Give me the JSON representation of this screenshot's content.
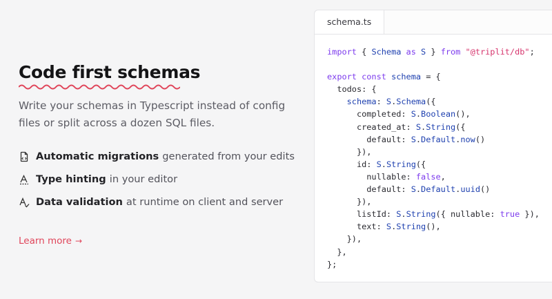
{
  "section": {
    "title": "Code first schemas",
    "description": "Write your schemas in Typescript instead of config files or split across a dozen SQL files.",
    "features": [
      {
        "icon": "file-code-icon",
        "bold": "Automatic migrations",
        "rest": "generated from your edits"
      },
      {
        "icon": "text-hint-icon",
        "bold": "Type hinting",
        "rest": "in your editor"
      },
      {
        "icon": "text-check-icon",
        "bold": "Data validation",
        "rest": "at runtime on client and server"
      }
    ],
    "learn_more": "Learn more",
    "learn_more_arrow": "→"
  },
  "editor": {
    "tab": "schema.ts",
    "code_lines": [
      [
        [
          "kw",
          "import"
        ],
        [
          "pr",
          " { "
        ],
        [
          "id",
          "Schema"
        ],
        [
          "kw",
          " as "
        ],
        [
          "id",
          "S"
        ],
        [
          "pr",
          " } "
        ],
        [
          "kw",
          "from"
        ],
        [
          "pr",
          " "
        ],
        [
          "st",
          "\"@triplit/db\""
        ],
        [
          "pr",
          ";"
        ]
      ],
      [],
      [
        [
          "kw",
          "export const "
        ],
        [
          "id",
          "schema"
        ],
        [
          "pr",
          " = {"
        ]
      ],
      [
        [
          "pr",
          "  todos: {"
        ]
      ],
      [
        [
          "pr",
          "    "
        ],
        [
          "id",
          "schema"
        ],
        [
          "pr",
          ": "
        ],
        [
          "id",
          "S"
        ],
        [
          "pr",
          "."
        ],
        [
          "fn",
          "Schema"
        ],
        [
          "pr",
          "({"
        ]
      ],
      [
        [
          "pr",
          "      completed: "
        ],
        [
          "id",
          "S"
        ],
        [
          "pr",
          "."
        ],
        [
          "fn",
          "Boolean"
        ],
        [
          "pr",
          "(),"
        ]
      ],
      [
        [
          "pr",
          "      created_at: "
        ],
        [
          "id",
          "S"
        ],
        [
          "pr",
          "."
        ],
        [
          "fn",
          "String"
        ],
        [
          "pr",
          "({"
        ]
      ],
      [
        [
          "pr",
          "        default: "
        ],
        [
          "id",
          "S"
        ],
        [
          "pr",
          "."
        ],
        [
          "fn",
          "Default"
        ],
        [
          "pr",
          "."
        ],
        [
          "fn",
          "now"
        ],
        [
          "pr",
          "()"
        ]
      ],
      [
        [
          "pr",
          "      }),"
        ]
      ],
      [
        [
          "pr",
          "      id: "
        ],
        [
          "id",
          "S"
        ],
        [
          "pr",
          "."
        ],
        [
          "fn",
          "String"
        ],
        [
          "pr",
          "({"
        ]
      ],
      [
        [
          "pr",
          "        nullable: "
        ],
        [
          "kw",
          "false"
        ],
        [
          "pr",
          ","
        ]
      ],
      [
        [
          "pr",
          "        default: "
        ],
        [
          "id",
          "S"
        ],
        [
          "pr",
          "."
        ],
        [
          "fn",
          "Default"
        ],
        [
          "pr",
          "."
        ],
        [
          "fn",
          "uuid"
        ],
        [
          "pr",
          "()"
        ]
      ],
      [
        [
          "pr",
          "      }),"
        ]
      ],
      [
        [
          "pr",
          "      listId: "
        ],
        [
          "id",
          "S"
        ],
        [
          "pr",
          "."
        ],
        [
          "fn",
          "String"
        ],
        [
          "pr",
          "({ nullable: "
        ],
        [
          "kw",
          "true"
        ],
        [
          "pr",
          " }),"
        ]
      ],
      [
        [
          "pr",
          "      text: "
        ],
        [
          "id",
          "S"
        ],
        [
          "pr",
          "."
        ],
        [
          "fn",
          "String"
        ],
        [
          "pr",
          "(),"
        ]
      ],
      [
        [
          "pr",
          "    }),"
        ]
      ],
      [
        [
          "pr",
          "  },"
        ]
      ],
      [
        [
          "pr",
          "};"
        ]
      ]
    ]
  },
  "colors": {
    "accent": "#e0455a",
    "keyword": "#7c3aed",
    "string": "#d6336c",
    "identifier": "#1e40af"
  }
}
